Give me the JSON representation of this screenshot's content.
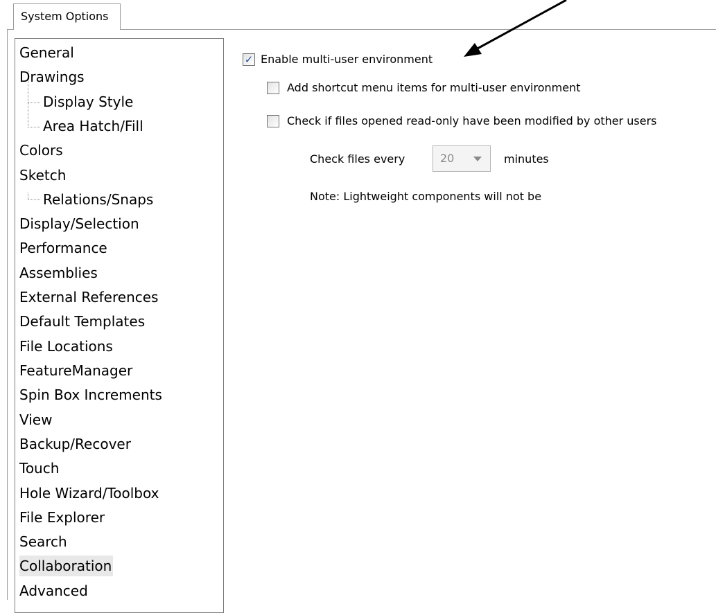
{
  "tab": {
    "label": "System Options"
  },
  "tree": {
    "items": [
      {
        "label": "General",
        "child": false
      },
      {
        "label": "Drawings",
        "child": false
      },
      {
        "label": "Display Style",
        "child": true
      },
      {
        "label": "Area Hatch/Fill",
        "child": true
      },
      {
        "label": "Colors",
        "child": false
      },
      {
        "label": "Sketch",
        "child": false
      },
      {
        "label": "Relations/Snaps",
        "child": true
      },
      {
        "label": "Display/Selection",
        "child": false
      },
      {
        "label": "Performance",
        "child": false
      },
      {
        "label": "Assemblies",
        "child": false
      },
      {
        "label": "External References",
        "child": false
      },
      {
        "label": "Default Templates",
        "child": false
      },
      {
        "label": "File Locations",
        "child": false
      },
      {
        "label": "FeatureManager",
        "child": false
      },
      {
        "label": "Spin Box Increments",
        "child": false
      },
      {
        "label": "View",
        "child": false
      },
      {
        "label": "Backup/Recover",
        "child": false
      },
      {
        "label": "Touch",
        "child": false
      },
      {
        "label": "Hole Wizard/Toolbox",
        "child": false
      },
      {
        "label": "File Explorer",
        "child": false
      },
      {
        "label": "Search",
        "child": false
      },
      {
        "label": "Collaboration",
        "child": false,
        "selected": true
      },
      {
        "label": "Advanced",
        "child": false
      }
    ]
  },
  "options": {
    "enable_multi_user": {
      "label": "Enable multi-user environment",
      "checked": true
    },
    "add_shortcut_menu": {
      "label": "Add shortcut menu items for multi-user environment",
      "checked": false
    },
    "check_read_only": {
      "label": "Check if files opened read-only have been modified by other users",
      "checked": false
    },
    "check_files_every_label": "Check files every",
    "check_interval_value": "20",
    "minutes_label": "minutes",
    "note": "Note: Lightweight components will not be"
  },
  "icons": {
    "check_mark": "✓"
  }
}
